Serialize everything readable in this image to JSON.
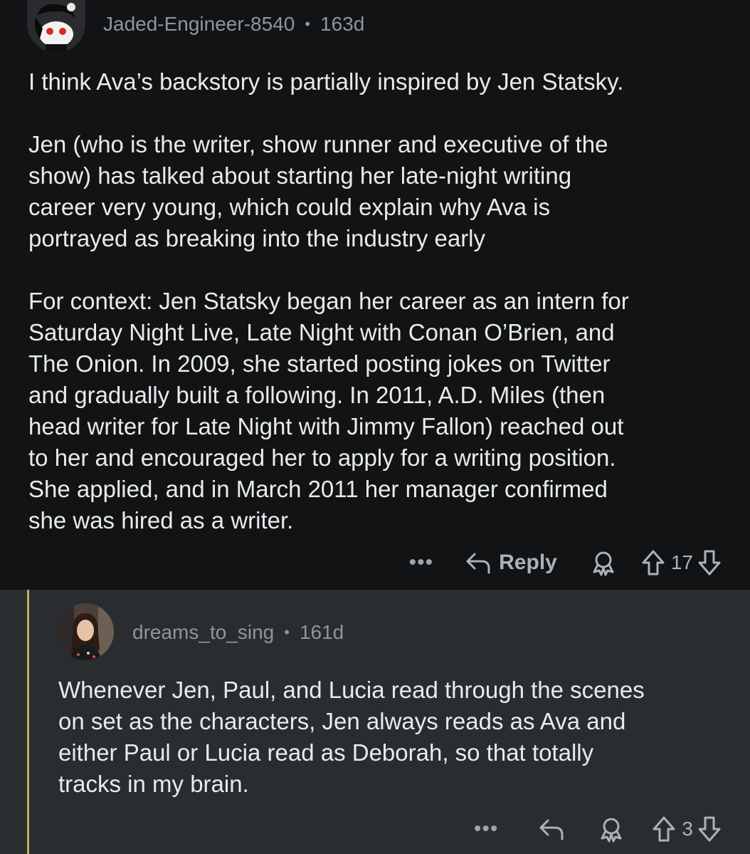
{
  "comments": [
    {
      "username": "Jaded-Engineer-8540",
      "separator": "•",
      "age": "163d",
      "paragraphs": [
        "I think Ava’s backstory is partially inspired by Jen Statsky.",
        "Jen (who is the writer, show runner and executive of the\nshow) has talked about starting her late-night writing\ncareer very young, which could explain why Ava is\nportrayed as breaking into the industry early",
        "For context: Jen Statsky began her career as an intern for\nSaturday Night Live, Late Night with Conan O’Brien, and\nThe Onion. In 2009, she started posting jokes on Twitter\nand gradually built a following. In 2011, A.D. Miles (then\nhead writer for Late Night with Jimmy Fallon) reached out\nto her and encouraged her to apply for a writing position.\nShe applied, and in March 2011 her manager confirmed\nshe was hired as a writer."
      ],
      "actions": {
        "more": "•••",
        "reply_label": "Reply",
        "vote_count": "17"
      }
    },
    {
      "username": "dreams_to_sing",
      "separator": "•",
      "age": "161d",
      "paragraphs": [
        "Whenever Jen, Paul, and Lucia read through the scenes\non set as the characters, Jen always reads as Ava and\neither Paul or Lucia read as Deborah, so that totally\ntracks in my brain."
      ],
      "actions": {
        "more": "•••",
        "vote_count": "3"
      }
    }
  ],
  "icons": {
    "reply": "reply-arrow-icon",
    "award": "award-icon",
    "upvote": "upvote-arrow-icon",
    "downvote": "downvote-arrow-icon",
    "more": "more-dots-icon"
  },
  "colors": {
    "background_top": "#121314",
    "background_reply": "#292d2f",
    "thread_line": "#c8a85a",
    "meta_text": "#8b97a0",
    "body_text": "#e8ebed"
  }
}
